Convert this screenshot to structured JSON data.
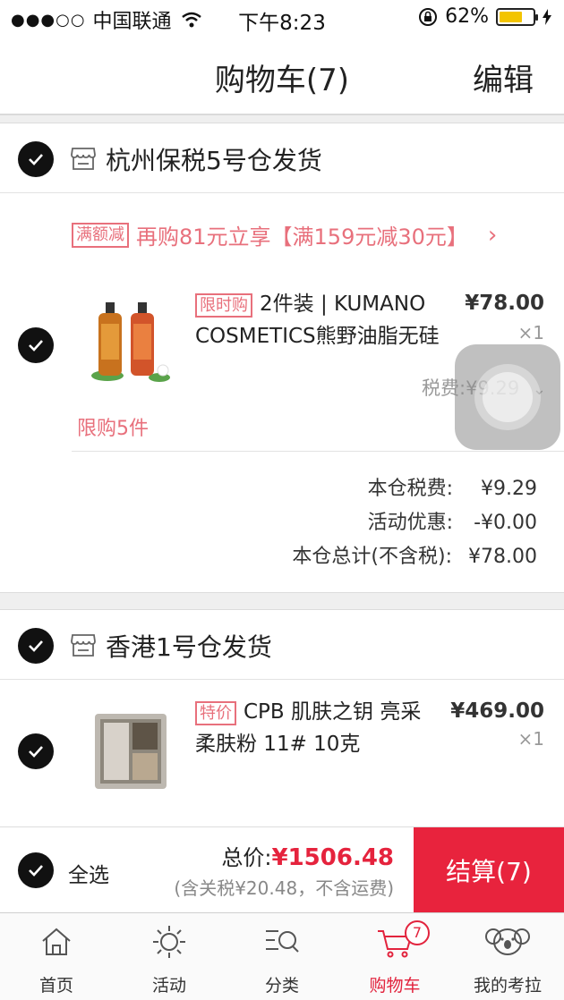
{
  "status_bar": {
    "signal": "●●●○○",
    "carrier": "中国联通",
    "time": "下午8:23",
    "battery": "62%"
  },
  "nav": {
    "title": "购物车(7)",
    "edit": "编辑"
  },
  "warehouses": [
    {
      "name": "杭州保税5号仓发货",
      "promo": {
        "tag": "满额减",
        "text": "再购81元立享【满159元减30元】"
      },
      "product": {
        "tag": "限时购",
        "title_line1": "2件装 | KUMANO",
        "title_line2": "COSMETICS熊野油脂无硅",
        "price": "¥78.00",
        "qty": "×1",
        "tax": "税费:¥9.29",
        "limit": "限购5件"
      },
      "summary": [
        {
          "label": "本仓税费:",
          "value": "¥9.29"
        },
        {
          "label": "活动优惠:",
          "value": "-¥0.00"
        },
        {
          "label": "本仓总计(不含税):",
          "value": "¥78.00"
        }
      ]
    },
    {
      "name": "香港1号仓发货",
      "product": {
        "tag": "特价",
        "title_line1": "CPB 肌肤之钥 亮采",
        "title_line2": "柔肤粉 11# 10克",
        "price": "¥469.00",
        "qty": "×1"
      }
    }
  ],
  "checkout": {
    "select_all": "全选",
    "total_label": "总价:",
    "total_amount": "¥1506.48",
    "note": "(含关税¥20.48，不含运费)",
    "pay_button": "结算(7)"
  },
  "tabs": [
    {
      "label": "首页",
      "icon": "home-icon"
    },
    {
      "label": "活动",
      "icon": "sun-icon"
    },
    {
      "label": "分类",
      "icon": "category-search-icon"
    },
    {
      "label": "购物车",
      "icon": "cart-icon",
      "badge": "7",
      "active": true
    },
    {
      "label": "我的考拉",
      "icon": "koala-icon"
    }
  ],
  "colors": {
    "accent": "#e8233d",
    "promo": "#e8707c"
  }
}
